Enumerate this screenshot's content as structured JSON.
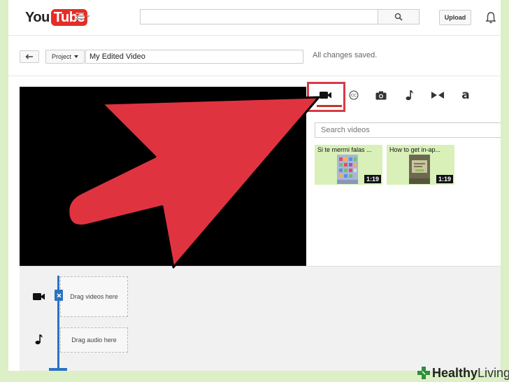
{
  "header": {
    "logo_you": "You",
    "logo_tube": "Tube",
    "upload_label": "Upload"
  },
  "toolbar": {
    "project_label": "Project",
    "title_value": "My Edited Video",
    "status_text": "All changes saved."
  },
  "library": {
    "search_placeholder": "Search videos",
    "videos": [
      {
        "title": "Si te merrni falas ...",
        "duration": "1:19"
      },
      {
        "title": "How to get in-ap...",
        "duration": "1:19"
      }
    ]
  },
  "timeline": {
    "video_drop_label": "Drag videos here",
    "audio_drop_label": "Drag audio here"
  },
  "watermark": {
    "bold": "Healthy",
    "light": "Living"
  },
  "colors": {
    "brand_red": "#e52d27",
    "highlight_red": "#d83a45",
    "playhead_blue": "#2a72c4",
    "watermark_bg": "#dcefc6"
  },
  "icons": [
    "guide-menu-icon",
    "search-icon",
    "bell-icon",
    "back-icon",
    "video-camera-icon",
    "closed-captions-icon",
    "photo-camera-icon",
    "music-note-icon",
    "transitions-icon",
    "text-icon",
    "healthy-living-cross-icon"
  ]
}
